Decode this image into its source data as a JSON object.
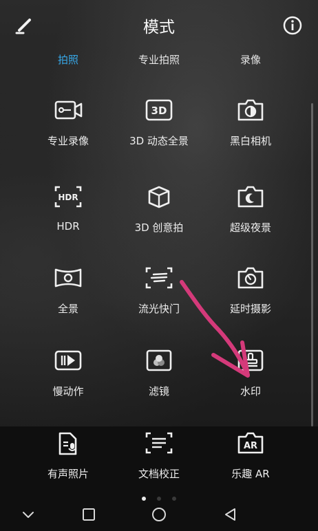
{
  "header": {
    "title": "模式"
  },
  "tabs": [
    "拍照",
    "专业拍照",
    "录像"
  ],
  "modes": [
    {
      "label": "专业录像",
      "icon": "pro-video-icon"
    },
    {
      "label": "3D 动态全景",
      "icon": "3d-badge-icon"
    },
    {
      "label": "黑白相机",
      "icon": "monochrome-camera-icon"
    },
    {
      "label": "HDR",
      "icon": "hdr-icon"
    },
    {
      "label": "3D 创意拍",
      "icon": "3d-cube-icon"
    },
    {
      "label": "超级夜景",
      "icon": "night-moon-icon"
    },
    {
      "label": "全景",
      "icon": "panorama-icon"
    },
    {
      "label": "流光快门",
      "icon": "light-trail-icon"
    },
    {
      "label": "延时摄影",
      "icon": "timelapse-icon"
    },
    {
      "label": "慢动作",
      "icon": "slow-motion-icon"
    },
    {
      "label": "滤镜",
      "icon": "filter-icon"
    },
    {
      "label": "水印",
      "icon": "watermark-stamp-icon"
    },
    {
      "label": "有声照片",
      "icon": "audio-note-icon"
    },
    {
      "label": "文档校正",
      "icon": "document-correct-icon"
    },
    {
      "label": "乐趣 AR",
      "icon": "ar-icon"
    }
  ],
  "colors": {
    "active_tab": "#37a8e8",
    "annotation_arrow": "#d43a7a"
  }
}
